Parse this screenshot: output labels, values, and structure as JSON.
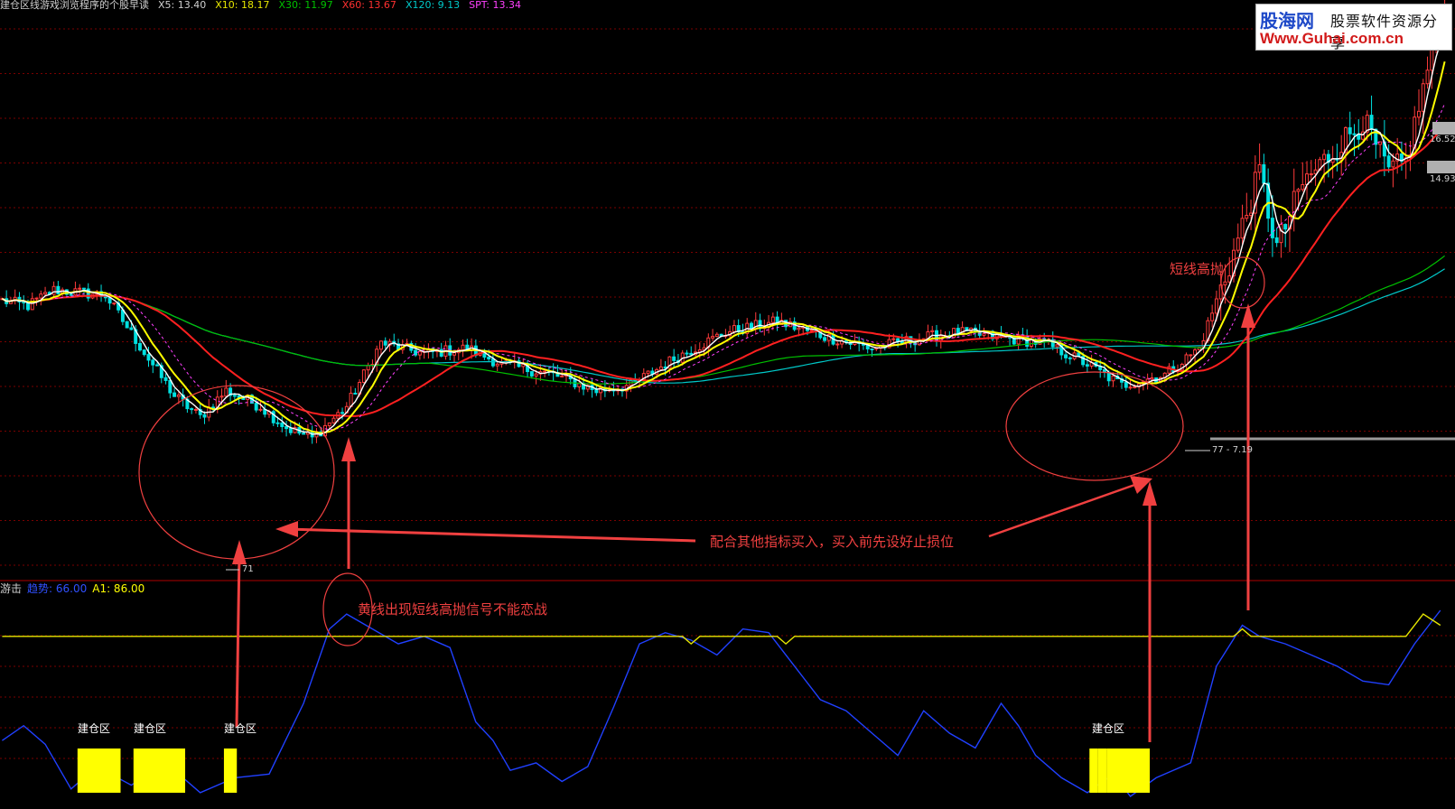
{
  "header": {
    "title": "建仓区线游戏浏览程序的个股早读",
    "values": [
      {
        "label": "X5:",
        "value": "13.40",
        "color": "#cfcfcf"
      },
      {
        "label": "X10:",
        "value": "18.17",
        "color": "#e6e600"
      },
      {
        "label": "X30:",
        "value": "11.97",
        "color": "#00c000"
      },
      {
        "label": "X60:",
        "value": "13.67",
        "color": "#ff3030"
      },
      {
        "label": "X120:",
        "value": "9.13",
        "color": "#00c8c8"
      },
      {
        "label": "SPT:",
        "value": "13.34",
        "color": "#ff40ff"
      }
    ]
  },
  "indicator_header": {
    "name": "游击",
    "items": [
      {
        "label": "趋势:",
        "value": "66.00",
        "color": "#3050ff"
      },
      {
        "label": "A1:",
        "value": "86.00",
        "color": "#ffff00"
      }
    ]
  },
  "watermark": {
    "brand": "股海网",
    "tagline": "股票软件资源分享",
    "url": "Www.Guhai.com.cn"
  },
  "colors": {
    "up": "#ff3b3b",
    "down": "#00e0e0",
    "ma5": "#ffffff",
    "ma10": "#ffff00",
    "ma30": "#00c000",
    "ma60": "#ff2020",
    "ma120": "#00c8c8",
    "spt": "#ff40ff",
    "trend": "#2040ff",
    "a1": "#e6e600",
    "zone": "#ffff00",
    "annotation": "#f04040",
    "grid": "#7a0000"
  },
  "annotations": {
    "buy_hint": "配合其他指标买入，买入前先设好止损位",
    "yellow_warning": "黄线出现短线高抛信号不能恋战",
    "short_sell": "短线高抛"
  },
  "price_labels": {
    "low": "71",
    "range": "77 - 7.19",
    "top1": "16.52",
    "top2": "14.93"
  },
  "chart_data": [
    {
      "type": "candlestick",
      "title": "",
      "series": [
        {
          "name": "X5"
        },
        {
          "name": "X10"
        },
        {
          "name": "X30"
        },
        {
          "name": "X60"
        },
        {
          "name": "X120"
        },
        {
          "name": "SPT"
        }
      ],
      "y_range": [
        6.5,
        17.0
      ],
      "grid": true,
      "segments": [
        [
          0,
          11.6
        ],
        [
          6,
          11.5
        ],
        [
          12,
          11.8
        ],
        [
          24,
          11.7
        ],
        [
          34,
          10.5
        ],
        [
          40,
          9.8
        ],
        [
          46,
          9.4
        ],
        [
          52,
          9.9
        ],
        [
          60,
          9.6
        ],
        [
          66,
          9.2
        ],
        [
          72,
          9.0
        ],
        [
          80,
          9.6
        ],
        [
          88,
          10.8
        ],
        [
          98,
          10.6
        ],
        [
          108,
          10.7
        ],
        [
          116,
          10.4
        ],
        [
          128,
          10.2
        ],
        [
          138,
          9.9
        ],
        [
          146,
          10.0
        ],
        [
          156,
          10.5
        ],
        [
          168,
          11.0
        ],
        [
          180,
          11.2
        ],
        [
          192,
          10.9
        ],
        [
          202,
          10.7
        ],
        [
          214,
          10.9
        ],
        [
          222,
          11.0
        ],
        [
          232,
          10.9
        ],
        [
          242,
          10.8
        ],
        [
          252,
          10.4
        ],
        [
          260,
          10.0
        ],
        [
          270,
          10.2
        ],
        [
          278,
          10.7
        ],
        [
          286,
          12.5
        ],
        [
          292,
          14.0
        ],
        [
          296,
          12.6
        ],
        [
          302,
          13.8
        ],
        [
          310,
          14.5
        ],
        [
          316,
          15.0
        ],
        [
          322,
          14.0
        ],
        [
          326,
          14.2
        ],
        [
          334,
          17.0
        ]
      ],
      "x_count": 336
    },
    {
      "type": "line",
      "title": "",
      "series": [
        {
          "name": "趋势",
          "points": [
            [
              0,
              30
            ],
            [
              5,
              38
            ],
            [
              10,
              28
            ],
            [
              16,
              4
            ],
            [
              22,
              16
            ],
            [
              30,
              6
            ],
            [
              38,
              18
            ],
            [
              46,
              2
            ],
            [
              54,
              10
            ],
            [
              62,
              12
            ],
            [
              70,
              50
            ],
            [
              76,
              90
            ],
            [
              80,
              98
            ],
            [
              86,
              90
            ],
            [
              92,
              82
            ],
            [
              98,
              86
            ],
            [
              104,
              80
            ],
            [
              110,
              40
            ],
            [
              114,
              30
            ],
            [
              118,
              14
            ],
            [
              124,
              18
            ],
            [
              130,
              8
            ],
            [
              136,
              16
            ],
            [
              142,
              48
            ],
            [
              148,
              82
            ],
            [
              154,
              88
            ],
            [
              160,
              84
            ],
            [
              166,
              76
            ],
            [
              172,
              90
            ],
            [
              178,
              88
            ],
            [
              184,
              70
            ],
            [
              190,
              52
            ],
            [
              196,
              46
            ],
            [
              202,
              34
            ],
            [
              208,
              22
            ],
            [
              214,
              46
            ],
            [
              220,
              34
            ],
            [
              226,
              26
            ],
            [
              232,
              50
            ],
            [
              236,
              38
            ],
            [
              240,
              22
            ],
            [
              246,
              10
            ],
            [
              252,
              2
            ],
            [
              258,
              12
            ],
            [
              262,
              0
            ],
            [
              268,
              10
            ],
            [
              276,
              18
            ],
            [
              282,
              70
            ],
            [
              288,
              92
            ],
            [
              292,
              86
            ],
            [
              298,
              82
            ],
            [
              304,
              76
            ],
            [
              310,
              70
            ],
            [
              316,
              62
            ],
            [
              322,
              60
            ],
            [
              328,
              82
            ],
            [
              334,
              100
            ]
          ]
        },
        {
          "name": "A1",
          "points": [
            [
              0,
              86
            ],
            [
              158,
              86
            ],
            [
              160,
              82
            ],
            [
              162,
              86
            ],
            [
              180,
              86
            ],
            [
              182,
              82
            ],
            [
              184,
              86
            ],
            [
              286,
              86
            ],
            [
              288,
              90
            ],
            [
              290,
              86
            ],
            [
              326,
              86
            ],
            [
              330,
              98
            ],
            [
              334,
              92
            ]
          ]
        }
      ],
      "y_range": [
        0,
        100
      ],
      "zones": [
        [
          18,
          27
        ],
        [
          31,
          42
        ],
        [
          52,
          54
        ],
        [
          253,
          254
        ],
        [
          255,
          256
        ],
        [
          257,
          266
        ]
      ],
      "zone_label": "建仓区"
    }
  ]
}
